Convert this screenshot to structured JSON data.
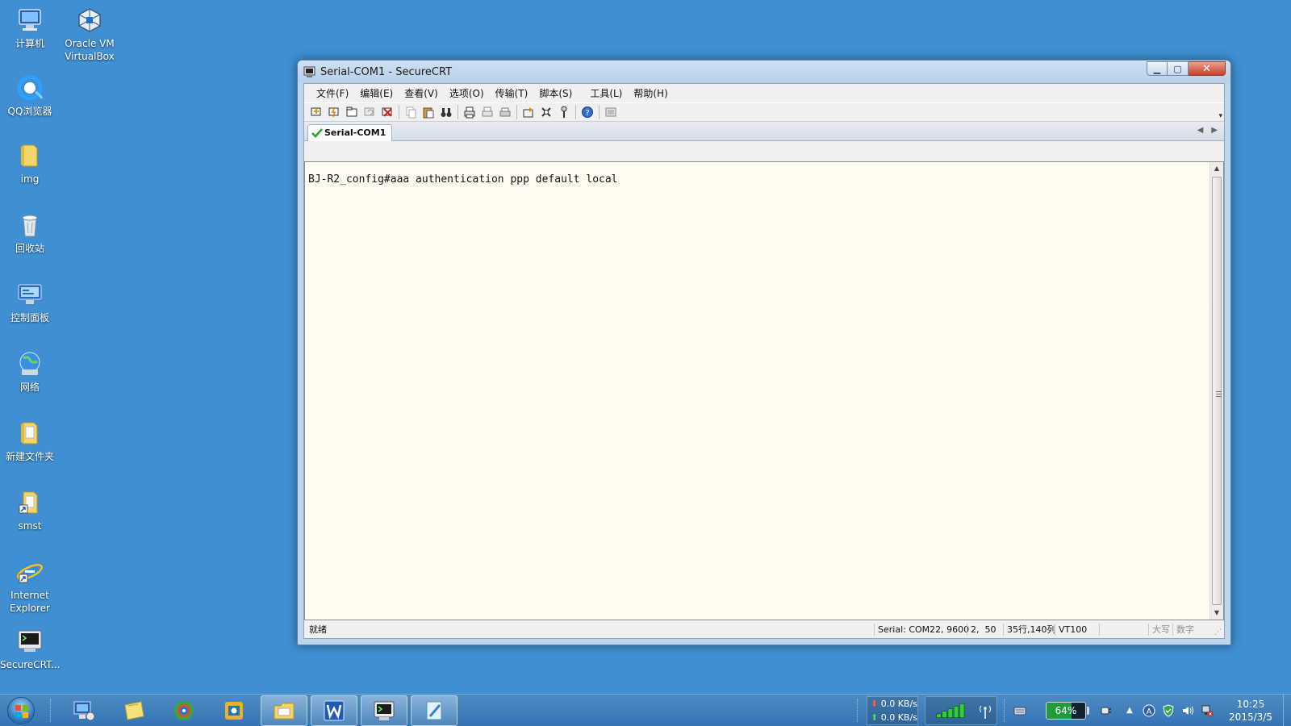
{
  "desktop": {
    "icons": [
      {
        "label": "计算机",
        "icon": "computer-icon"
      },
      {
        "label": "Oracle VM VirtualBox",
        "icon": "virtualbox-icon"
      },
      {
        "label": "QQ浏览器",
        "icon": "qq-browser-icon"
      },
      {
        "label": "img",
        "icon": "folder-icon"
      },
      {
        "label": "回收站",
        "icon": "recycle-bin-icon"
      },
      {
        "label": "控制面板",
        "icon": "control-panel-icon"
      },
      {
        "label": "网络",
        "icon": "network-icon"
      },
      {
        "label": "新建文件夹",
        "icon": "folder-icon"
      },
      {
        "label": "smst",
        "icon": "folder-shortcut-icon"
      },
      {
        "label": "Internet Explorer",
        "icon": "internet-explorer-icon"
      },
      {
        "label": "SecureCRT...",
        "icon": "securecrt-icon"
      }
    ]
  },
  "window": {
    "title": "Serial-COM1 - SecureCRT",
    "menu": [
      "文件(F)",
      "编辑(E)",
      "查看(V)",
      "选项(O)",
      "传输(T)",
      "脚本(S)",
      "工具(L)",
      "帮助(H)"
    ],
    "tab": "Serial-COM1",
    "terminal_line": "BJ-R2_config#aaa authentication ppp default local",
    "status": {
      "ready": "就绪",
      "serial": "Serial: COM22, 9600",
      "cursor": "2,  50",
      "size": "35行,140列",
      "emulation": "VT100",
      "caps": "大写",
      "num": "数字"
    }
  },
  "taskbar": {
    "net_down": "0.0 KB/s",
    "net_up": "0.0 KB/s",
    "battery": "64%",
    "battery_level": 0.64,
    "time": "10:25",
    "date": "2015/3/5"
  },
  "colors": {
    "desktop": "#3f8fd2",
    "terminal_bg": "#fffbf0",
    "taskbar": "#3474b3"
  }
}
